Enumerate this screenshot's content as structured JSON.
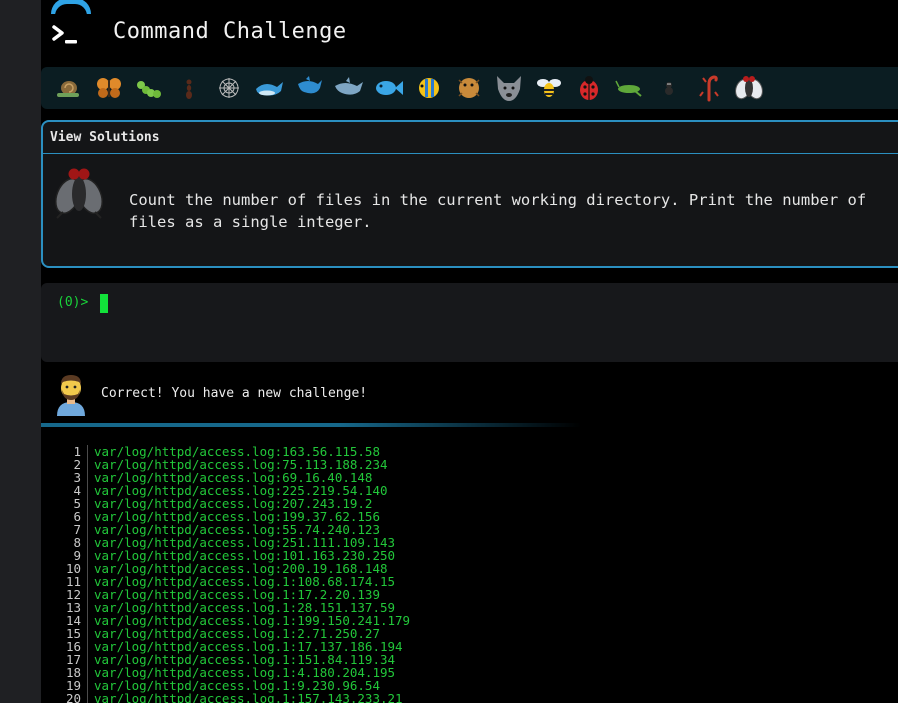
{
  "header": {
    "title": "Command Challenge"
  },
  "emoji_bar": {
    "icons": [
      "snail-icon",
      "butterfly-icon",
      "caterpillar-icon",
      "ant-icon",
      "spiderweb-icon",
      "whale-icon",
      "dolphin-icon",
      "dolphin-2-icon",
      "fish-icon",
      "tropical-fish-icon",
      "blowfish-icon",
      "wolf-icon",
      "bee-icon",
      "ladybug-icon",
      "cricket-icon",
      "spider-icon",
      "scorpion-icon",
      "fly-icon"
    ]
  },
  "challenge": {
    "view_solutions_label": "View Solutions",
    "description": "Count the number of files in the current working directory. Print the number of files as a single integer."
  },
  "terminal": {
    "prompt": "(0)>"
  },
  "feedback": {
    "message": "Correct! You have a new challenge!"
  },
  "output": {
    "lines": [
      {
        "n": "1",
        "text": "var/log/httpd/access.log:163.56.115.58"
      },
      {
        "n": "2",
        "text": "var/log/httpd/access.log:75.113.188.234"
      },
      {
        "n": "3",
        "text": "var/log/httpd/access.log:69.16.40.148"
      },
      {
        "n": "4",
        "text": "var/log/httpd/access.log:225.219.54.140"
      },
      {
        "n": "5",
        "text": "var/log/httpd/access.log:207.243.19.2"
      },
      {
        "n": "6",
        "text": "var/log/httpd/access.log:199.37.62.156"
      },
      {
        "n": "7",
        "text": "var/log/httpd/access.log:55.74.240.123"
      },
      {
        "n": "8",
        "text": "var/log/httpd/access.log:251.111.109.143"
      },
      {
        "n": "9",
        "text": "var/log/httpd/access.log:101.163.230.250"
      },
      {
        "n": "10",
        "text": "var/log/httpd/access.log:200.19.168.148"
      },
      {
        "n": "11",
        "text": "var/log/httpd/access.log.1:108.68.174.15"
      },
      {
        "n": "12",
        "text": "var/log/httpd/access.log.1:17.2.20.139"
      },
      {
        "n": "13",
        "text": "var/log/httpd/access.log.1:28.151.137.59"
      },
      {
        "n": "14",
        "text": "var/log/httpd/access.log.1:199.150.241.179"
      },
      {
        "n": "15",
        "text": "var/log/httpd/access.log.1:2.71.250.27"
      },
      {
        "n": "16",
        "text": "var/log/httpd/access.log.1:17.137.186.194"
      },
      {
        "n": "17",
        "text": "var/log/httpd/access.log.1:151.84.119.34"
      },
      {
        "n": "18",
        "text": "var/log/httpd/access.log.1:4.180.204.195"
      },
      {
        "n": "19",
        "text": "var/log/httpd/access.log.1:9.230.96.54"
      },
      {
        "n": "20",
        "text": "var/log/httpd/access.log.1:157.143.233.21"
      }
    ]
  },
  "colors": {
    "accent": "#2b8fc0",
    "terminal_green": "#22c73a",
    "background": "#000000",
    "panel": "#141517"
  }
}
